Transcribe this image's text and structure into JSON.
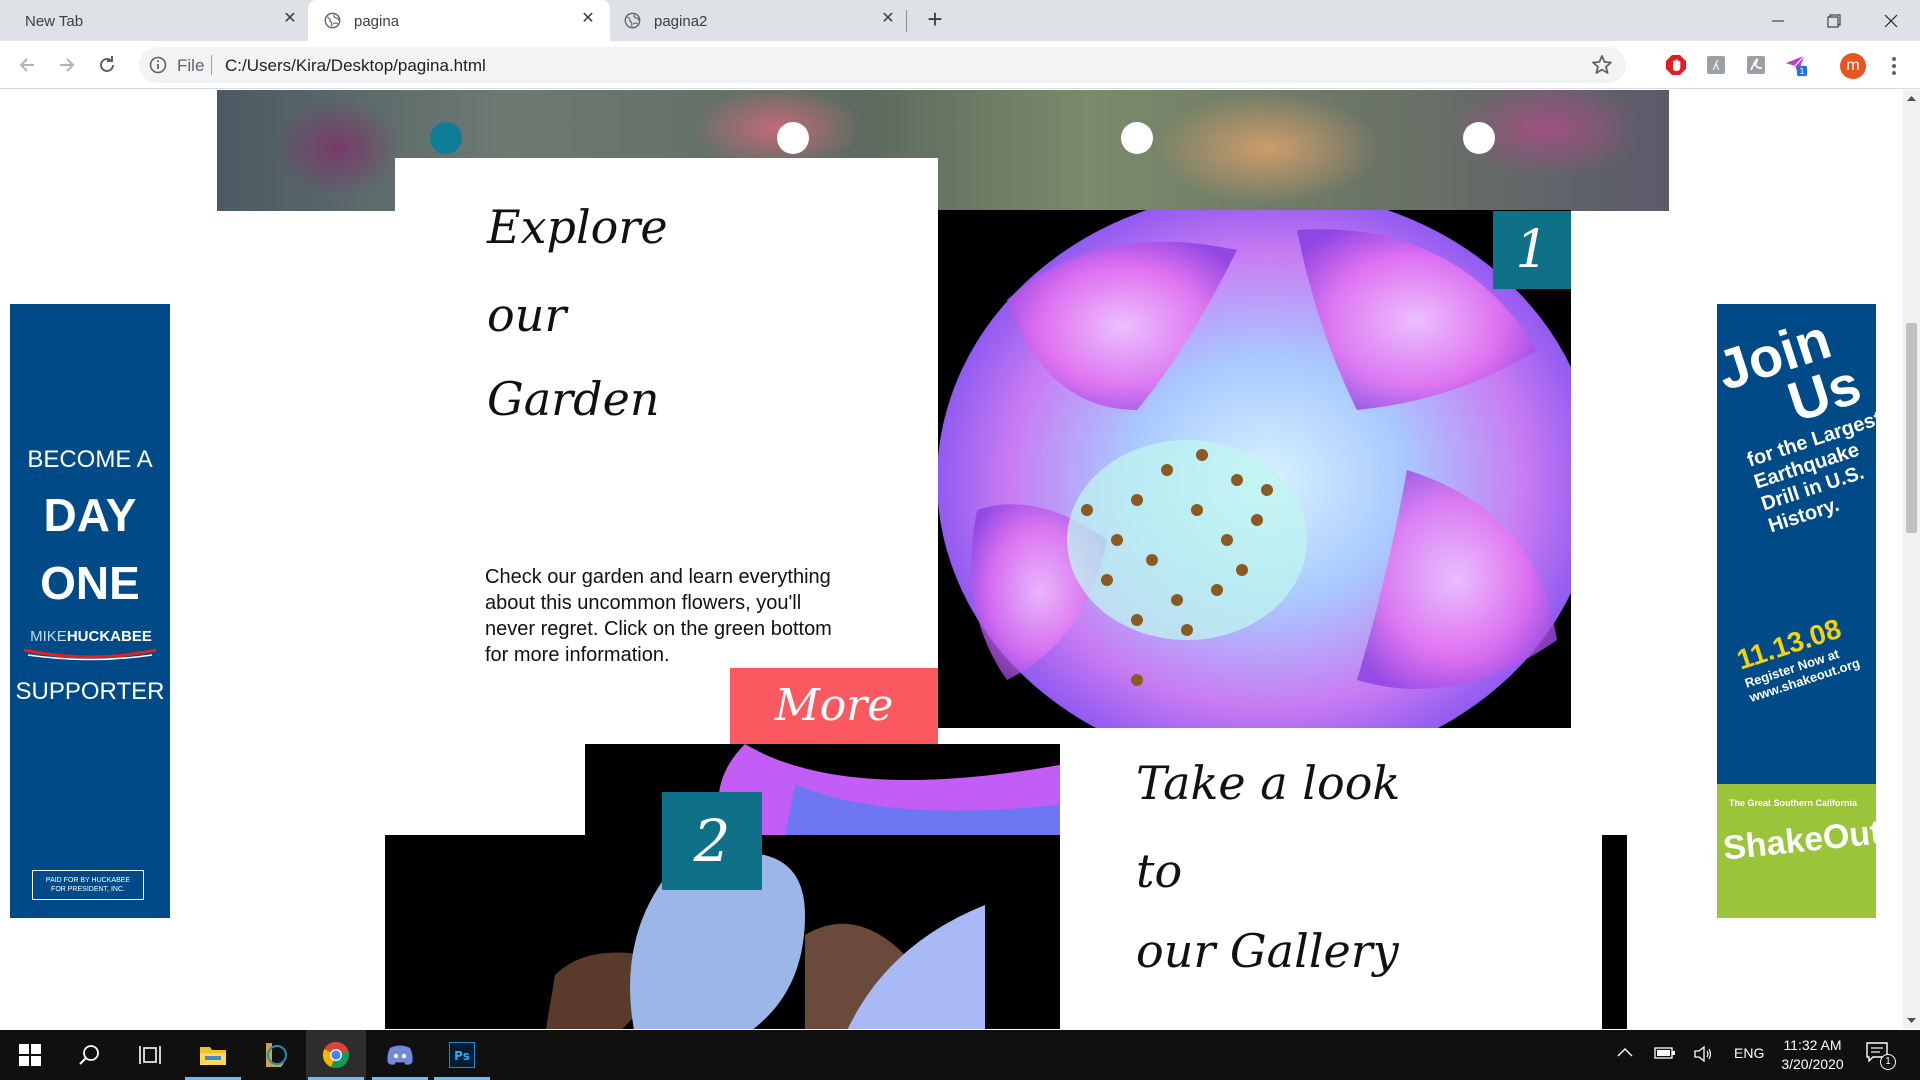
{
  "browser": {
    "tabs": [
      {
        "label": "New Tab",
        "active": false
      },
      {
        "label": "pagina",
        "active": true
      },
      {
        "label": "pagina2",
        "active": false
      }
    ],
    "address": {
      "scheme": "File",
      "url": "C:/Users/Kira/Desktop/pagina.html"
    },
    "profile_initial": "m",
    "extension_badge": "1"
  },
  "page": {
    "slider_dots": 4,
    "active_dot": 1,
    "explore_card": {
      "title_lines": [
        "Explore",
        "our",
        "Garden"
      ],
      "body": "Check our garden and learn everything about this uncommon flowers, you'll never regret. Click on the green bottom for more information.",
      "more_label": "More"
    },
    "badge_1": "1",
    "badge_2": "2",
    "gallery_card": {
      "title_lines": [
        "Take a look",
        "to",
        "our Gallery"
      ]
    },
    "ad_left": {
      "line1": "BECOME A",
      "line2": "DAY",
      "line3": "ONE",
      "brand_first": "MIKE",
      "brand_last": "HUCKABEE",
      "line4": "SUPPORTER",
      "paid_by": "PAID FOR BY HUCKABEE FOR PRESIDENT, INC."
    },
    "ad_right": {
      "headline1": "Join",
      "headline2": "Us",
      "subtitle": "for the Largest Earthquake Drill in U.S. History.",
      "date": "11.13.08",
      "register": "Register Now at www.shakeout.org",
      "event_small": "The Great Southern California",
      "event_big": "ShakeOut",
      "accent_color": "#9ac43a"
    }
  },
  "taskbar": {
    "language": "ENG",
    "time": "11:32 AM",
    "date": "3/20/2020",
    "notification_count": "1"
  }
}
